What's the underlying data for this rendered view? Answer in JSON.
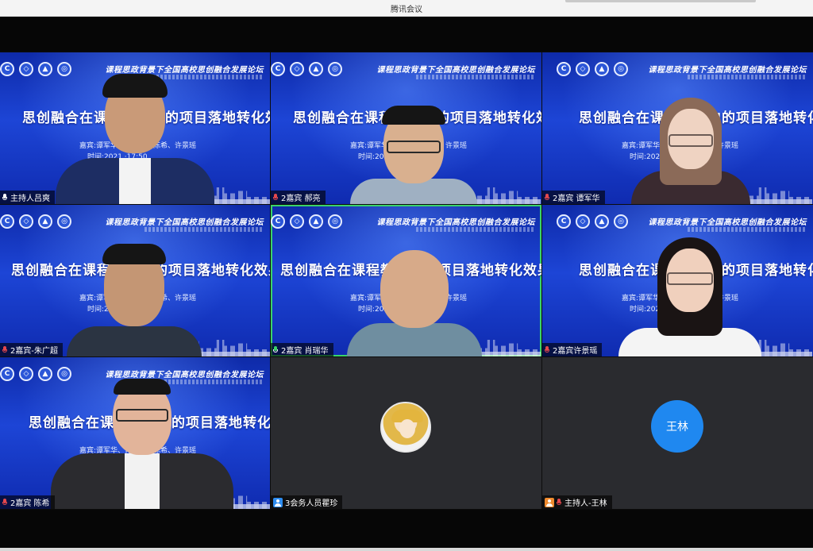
{
  "app": {
    "title": "腾讯会议"
  },
  "banner": {
    "forum_title": "课程思政背景下全国高校思创融合发展论坛",
    "seminar_title": "思创融合在课程教学中的项目落地转化效果研讨",
    "guests": "嘉宾:谭军华、肖瑞华、陈希、许景瑶",
    "time": "时间:2021 ·17:50",
    "logos": [
      "C",
      "◇",
      "▲",
      "◎"
    ]
  },
  "participants": [
    {
      "name": "主持人吕爽",
      "audio": "on"
    },
    {
      "name": "2嘉宾 郝亮",
      "audio": "muted"
    },
    {
      "name": "2嘉宾 谭军华",
      "audio": "muted"
    },
    {
      "name": "2嘉宾-朱广超",
      "audio": "muted"
    },
    {
      "name": "2嘉宾 肖瑞华",
      "audio": "speaking"
    },
    {
      "name": "2嘉宾许景瑶",
      "audio": "muted"
    },
    {
      "name": "2嘉宾 陈希",
      "audio": "muted"
    },
    {
      "name": "3会务人员瞿珍",
      "audio": "none"
    },
    {
      "name": "主持人-王林",
      "audio": "muted",
      "avatar_text": "王林"
    }
  ],
  "colors": {
    "accent_blue": "#1f88f0",
    "speaking_green": "#3bd36a",
    "muted_red": "#e5484d",
    "user_icon_blue": "#2d8cf0",
    "user_icon_orange": "#f08a2d"
  }
}
